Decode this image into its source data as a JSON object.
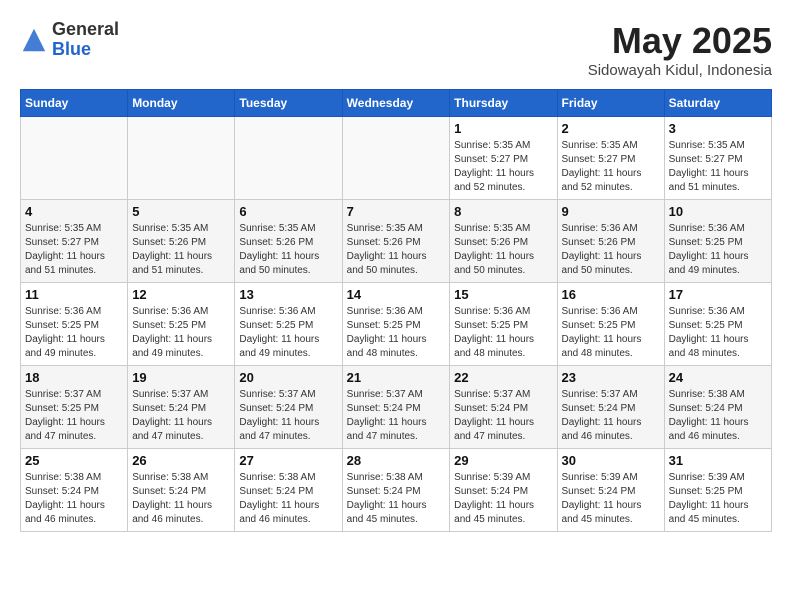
{
  "header": {
    "logo_general": "General",
    "logo_blue": "Blue",
    "month_title": "May 2025",
    "location": "Sidowayah Kidul, Indonesia"
  },
  "weekdays": [
    "Sunday",
    "Monday",
    "Tuesday",
    "Wednesday",
    "Thursday",
    "Friday",
    "Saturday"
  ],
  "weeks": [
    [
      {
        "day": "",
        "sunrise": "",
        "sunset": "",
        "daylight": ""
      },
      {
        "day": "",
        "sunrise": "",
        "sunset": "",
        "daylight": ""
      },
      {
        "day": "",
        "sunrise": "",
        "sunset": "",
        "daylight": ""
      },
      {
        "day": "",
        "sunrise": "",
        "sunset": "",
        "daylight": ""
      },
      {
        "day": "1",
        "sunrise": "Sunrise: 5:35 AM",
        "sunset": "Sunset: 5:27 PM",
        "daylight": "Daylight: 11 hours and 52 minutes."
      },
      {
        "day": "2",
        "sunrise": "Sunrise: 5:35 AM",
        "sunset": "Sunset: 5:27 PM",
        "daylight": "Daylight: 11 hours and 52 minutes."
      },
      {
        "day": "3",
        "sunrise": "Sunrise: 5:35 AM",
        "sunset": "Sunset: 5:27 PM",
        "daylight": "Daylight: 11 hours and 51 minutes."
      }
    ],
    [
      {
        "day": "4",
        "sunrise": "Sunrise: 5:35 AM",
        "sunset": "Sunset: 5:27 PM",
        "daylight": "Daylight: 11 hours and 51 minutes."
      },
      {
        "day": "5",
        "sunrise": "Sunrise: 5:35 AM",
        "sunset": "Sunset: 5:26 PM",
        "daylight": "Daylight: 11 hours and 51 minutes."
      },
      {
        "day": "6",
        "sunrise": "Sunrise: 5:35 AM",
        "sunset": "Sunset: 5:26 PM",
        "daylight": "Daylight: 11 hours and 50 minutes."
      },
      {
        "day": "7",
        "sunrise": "Sunrise: 5:35 AM",
        "sunset": "Sunset: 5:26 PM",
        "daylight": "Daylight: 11 hours and 50 minutes."
      },
      {
        "day": "8",
        "sunrise": "Sunrise: 5:35 AM",
        "sunset": "Sunset: 5:26 PM",
        "daylight": "Daylight: 11 hours and 50 minutes."
      },
      {
        "day": "9",
        "sunrise": "Sunrise: 5:36 AM",
        "sunset": "Sunset: 5:26 PM",
        "daylight": "Daylight: 11 hours and 50 minutes."
      },
      {
        "day": "10",
        "sunrise": "Sunrise: 5:36 AM",
        "sunset": "Sunset: 5:25 PM",
        "daylight": "Daylight: 11 hours and 49 minutes."
      }
    ],
    [
      {
        "day": "11",
        "sunrise": "Sunrise: 5:36 AM",
        "sunset": "Sunset: 5:25 PM",
        "daylight": "Daylight: 11 hours and 49 minutes."
      },
      {
        "day": "12",
        "sunrise": "Sunrise: 5:36 AM",
        "sunset": "Sunset: 5:25 PM",
        "daylight": "Daylight: 11 hours and 49 minutes."
      },
      {
        "day": "13",
        "sunrise": "Sunrise: 5:36 AM",
        "sunset": "Sunset: 5:25 PM",
        "daylight": "Daylight: 11 hours and 49 minutes."
      },
      {
        "day": "14",
        "sunrise": "Sunrise: 5:36 AM",
        "sunset": "Sunset: 5:25 PM",
        "daylight": "Daylight: 11 hours and 48 minutes."
      },
      {
        "day": "15",
        "sunrise": "Sunrise: 5:36 AM",
        "sunset": "Sunset: 5:25 PM",
        "daylight": "Daylight: 11 hours and 48 minutes."
      },
      {
        "day": "16",
        "sunrise": "Sunrise: 5:36 AM",
        "sunset": "Sunset: 5:25 PM",
        "daylight": "Daylight: 11 hours and 48 minutes."
      },
      {
        "day": "17",
        "sunrise": "Sunrise: 5:36 AM",
        "sunset": "Sunset: 5:25 PM",
        "daylight": "Daylight: 11 hours and 48 minutes."
      }
    ],
    [
      {
        "day": "18",
        "sunrise": "Sunrise: 5:37 AM",
        "sunset": "Sunset: 5:25 PM",
        "daylight": "Daylight: 11 hours and 47 minutes."
      },
      {
        "day": "19",
        "sunrise": "Sunrise: 5:37 AM",
        "sunset": "Sunset: 5:24 PM",
        "daylight": "Daylight: 11 hours and 47 minutes."
      },
      {
        "day": "20",
        "sunrise": "Sunrise: 5:37 AM",
        "sunset": "Sunset: 5:24 PM",
        "daylight": "Daylight: 11 hours and 47 minutes."
      },
      {
        "day": "21",
        "sunrise": "Sunrise: 5:37 AM",
        "sunset": "Sunset: 5:24 PM",
        "daylight": "Daylight: 11 hours and 47 minutes."
      },
      {
        "day": "22",
        "sunrise": "Sunrise: 5:37 AM",
        "sunset": "Sunset: 5:24 PM",
        "daylight": "Daylight: 11 hours and 47 minutes."
      },
      {
        "day": "23",
        "sunrise": "Sunrise: 5:37 AM",
        "sunset": "Sunset: 5:24 PM",
        "daylight": "Daylight: 11 hours and 46 minutes."
      },
      {
        "day": "24",
        "sunrise": "Sunrise: 5:38 AM",
        "sunset": "Sunset: 5:24 PM",
        "daylight": "Daylight: 11 hours and 46 minutes."
      }
    ],
    [
      {
        "day": "25",
        "sunrise": "Sunrise: 5:38 AM",
        "sunset": "Sunset: 5:24 PM",
        "daylight": "Daylight: 11 hours and 46 minutes."
      },
      {
        "day": "26",
        "sunrise": "Sunrise: 5:38 AM",
        "sunset": "Sunset: 5:24 PM",
        "daylight": "Daylight: 11 hours and 46 minutes."
      },
      {
        "day": "27",
        "sunrise": "Sunrise: 5:38 AM",
        "sunset": "Sunset: 5:24 PM",
        "daylight": "Daylight: 11 hours and 46 minutes."
      },
      {
        "day": "28",
        "sunrise": "Sunrise: 5:38 AM",
        "sunset": "Sunset: 5:24 PM",
        "daylight": "Daylight: 11 hours and 45 minutes."
      },
      {
        "day": "29",
        "sunrise": "Sunrise: 5:39 AM",
        "sunset": "Sunset: 5:24 PM",
        "daylight": "Daylight: 11 hours and 45 minutes."
      },
      {
        "day": "30",
        "sunrise": "Sunrise: 5:39 AM",
        "sunset": "Sunset: 5:24 PM",
        "daylight": "Daylight: 11 hours and 45 minutes."
      },
      {
        "day": "31",
        "sunrise": "Sunrise: 5:39 AM",
        "sunset": "Sunset: 5:25 PM",
        "daylight": "Daylight: 11 hours and 45 minutes."
      }
    ]
  ]
}
